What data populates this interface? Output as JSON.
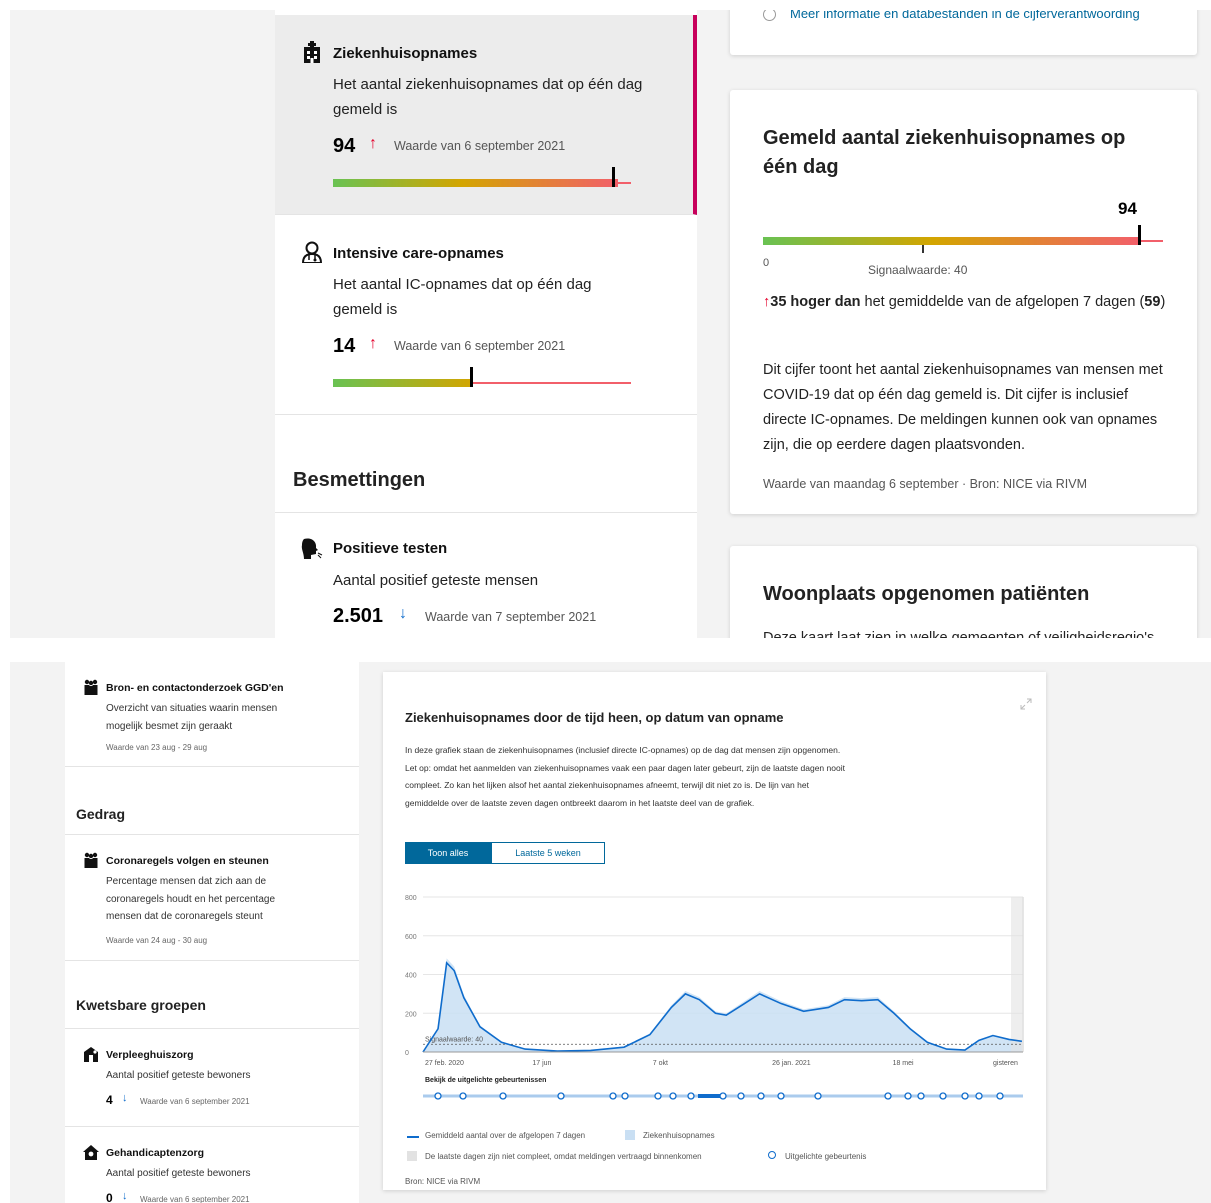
{
  "top": {
    "header_link": "Meer informatie en databestanden in de cijferverantwoording",
    "sidebar": {
      "items": [
        {
          "title": "Ziekenhuisopnames",
          "icon": "hospital-building-icon",
          "desc": "Het aantal ziekenhuisopnames dat op één dag gemeld is",
          "value": "94",
          "trend": "up",
          "date": "Waarde van 6 september 2021",
          "gauge_fraction": 0.94
        },
        {
          "title": "Intensive care-opnames",
          "icon": "doctor-icon",
          "desc": "Het aantal IC-opnames dat op één dag gemeld is",
          "value": "14",
          "trend": "up",
          "date": "Waarde van 6 september 2021",
          "gauge_fraction": 0.47
        }
      ],
      "section": "Besmettingen",
      "item3": {
        "title": "Positieve testen",
        "icon": "sneezing-head-icon",
        "desc": "Aantal positief geteste mensen",
        "value": "2.501",
        "trend": "down",
        "date": "Waarde van 7 september 2021"
      }
    },
    "card": {
      "title": "Gemeld aantal ziekenhuisopnames op één dag",
      "value": "94",
      "min_label": "0",
      "signal_label": "Signaalwaarde: 40",
      "diff_bold": "35 hoger dan",
      "diff_rest": "het gemiddelde van de afgelopen 7 dagen",
      "avg": "59",
      "text": "Dit cijfer toont het aantal ziekenhuisopnames van mensen met COVID-19 dat op één dag gemeld is. Dit cijfer is inclusief directe IC-opnames. De meldingen kunnen ook van opnames zijn, die op eerdere dagen plaatsvonden.",
      "source": "Waarde van maandag 6 september · Bron: NICE via RIVM"
    },
    "card2": {
      "title": "Woonplaats opgenomen patiënten",
      "text": "Deze kaart laat zien in welke gemeenten of veiligheidsregio's"
    }
  },
  "bottom": {
    "sidebar": {
      "item1": {
        "title": "Bron- en contactonderzoek GGD'en",
        "desc": "Overzicht van situaties waarin mensen mogelijk besmet zijn geraakt",
        "date": "Waarde van 23 aug - 29 aug"
      },
      "section1": "Gedrag",
      "item2": {
        "title": "Coronaregels volgen en steunen",
        "desc": "Percentage mensen dat zich aan de coronaregels houdt en het percentage mensen dat de coronaregels steunt",
        "date": "Waarde van 24 aug - 30 aug"
      },
      "section2": "Kwetsbare groepen",
      "item3": {
        "title": "Verpleeghuiszorg",
        "desc": "Aantal positief geteste bewoners",
        "value": "4",
        "date": "Waarde van 6 september 2021"
      },
      "item4": {
        "title": "Gehandicaptenzorg",
        "desc": "Aantal positief geteste bewoners",
        "value": "0",
        "date": "Waarde van 6 september 2021"
      }
    },
    "graph": {
      "title": "Ziekenhuisopnames door de tijd heen, op datum van opname",
      "text": "In deze grafiek staan de ziekenhuisopnames (inclusief directe IC-opnames) op de dag dat mensen zijn opgenomen. Let op: omdat het aanmelden van ziekenhuisopnames vaak een paar dagen later gebeurt, zijn de laatste dagen nooit compleet. Zo kan het lijken alsof het aantal ziekenhuisopnames afneemt, terwijl dit niet zo is. De lijn van het gemiddelde over de laatste zeven dagen ontbreekt daarom in het laatste deel van de grafiek.",
      "tab_all": "Toon alles",
      "tab_5w": "Laatste 5 weken",
      "signal_label": "Signaalwaarde: 40",
      "events_label": "Bekijk de uitgelichte gebeurtenissen",
      "legend_line": "Gemiddeld aantal over de afgelopen 7 dagen",
      "legend_bar": "Ziekenhuisopnames",
      "legend_incomplete": "De laatste dagen zijn niet compleet, omdat meldingen vertraagd binnenkomen",
      "legend_event": "Uitgelichte gebeurtenis",
      "source": "Bron: NICE via RIVM"
    }
  },
  "chart_data": {
    "type": "area",
    "title": "Ziekenhuisopnames door de tijd heen, op datum van opname",
    "xlabel": "",
    "ylabel": "",
    "ylim": [
      0,
      800
    ],
    "yticks": [
      0,
      200,
      400,
      600,
      800
    ],
    "xtick_labels": [
      "27 feb. 2020",
      "17 jun",
      "7 okt",
      "26 jan. 2021",
      "18 mei",
      "gisteren"
    ],
    "signal_value": 40,
    "series": [
      {
        "name": "Gemiddeld aantal over de afgelopen 7 dagen",
        "x": [
          "2020-02-27",
          "2020-03-12",
          "2020-03-20",
          "2020-03-27",
          "2020-04-05",
          "2020-04-20",
          "2020-05-10",
          "2020-06-01",
          "2020-07-01",
          "2020-08-01",
          "2020-09-01",
          "2020-09-25",
          "2020-10-15",
          "2020-10-28",
          "2020-11-10",
          "2020-11-25",
          "2020-12-05",
          "2020-12-22",
          "2021-01-05",
          "2021-01-25",
          "2021-02-15",
          "2021-03-10",
          "2021-03-25",
          "2021-04-10",
          "2021-04-25",
          "2021-05-10",
          "2021-05-25",
          "2021-06-10",
          "2021-06-28",
          "2021-07-15",
          "2021-07-28",
          "2021-08-10",
          "2021-08-25",
          "2021-09-06"
        ],
        "values": [
          0,
          120,
          460,
          420,
          280,
          130,
          50,
          15,
          5,
          8,
          25,
          90,
          230,
          300,
          270,
          200,
          190,
          250,
          300,
          250,
          210,
          230,
          270,
          265,
          270,
          200,
          120,
          50,
          15,
          10,
          60,
          85,
          65,
          55
        ]
      }
    ],
    "bars": "Ziekenhuisopnames (daily, light blue)",
    "colors": {
      "line": "#0f6ccc",
      "area": "#c9dff3",
      "signal": "#555555"
    }
  },
  "colors": {
    "accent": "#01689b",
    "active_border": "#c7005b",
    "up": "#e4002b",
    "down": "#0f6ccc"
  }
}
